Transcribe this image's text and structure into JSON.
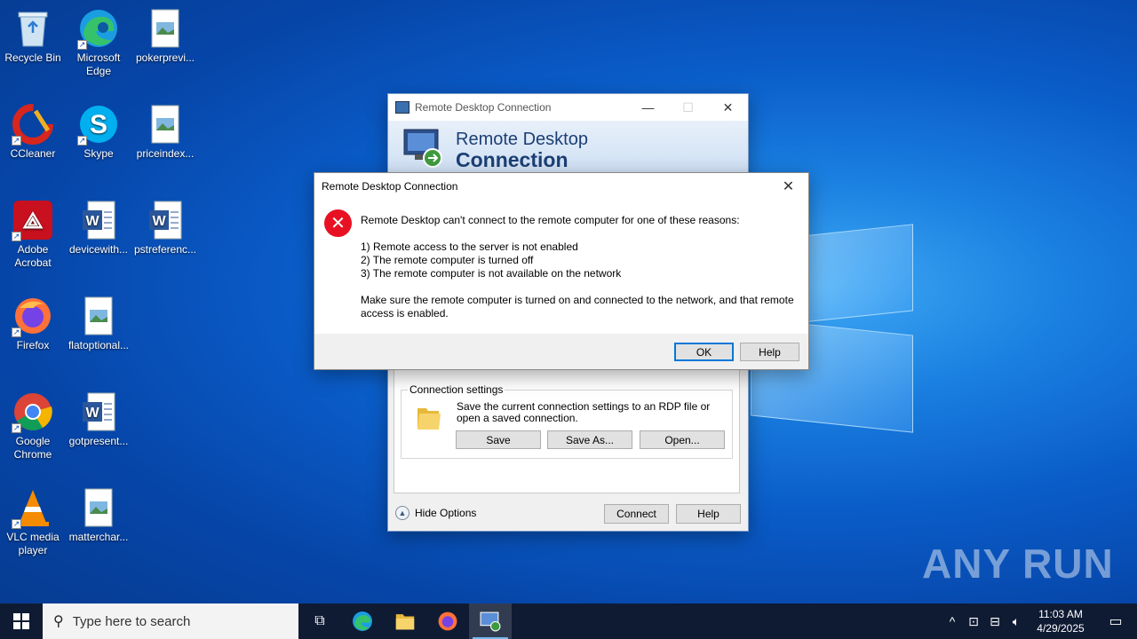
{
  "desktop": {
    "icons": [
      {
        "label": "Recycle Bin",
        "icon": "recycle-bin-icon"
      },
      {
        "label": "Microsoft Edge",
        "icon": "edge-icon"
      },
      {
        "label": "pokerprevi...",
        "icon": "image-file-icon"
      },
      {
        "label": "CCleaner",
        "icon": "ccleaner-icon"
      },
      {
        "label": "Skype",
        "icon": "skype-icon"
      },
      {
        "label": "priceindex...",
        "icon": "image-file-icon"
      },
      {
        "label": "Adobe Acrobat",
        "icon": "acrobat-icon"
      },
      {
        "label": "devicewith...",
        "icon": "word-doc-icon"
      },
      {
        "label": "pstreferenc...",
        "icon": "word-doc-icon"
      },
      {
        "label": "Firefox",
        "icon": "firefox-icon"
      },
      {
        "label": "flatoptional...",
        "icon": "image-file-icon"
      },
      {
        "label": "Google Chrome",
        "icon": "chrome-icon"
      },
      {
        "label": "gotpresent...",
        "icon": "word-doc-icon"
      },
      {
        "label": "VLC media player",
        "icon": "vlc-icon"
      },
      {
        "label": "matterchar...",
        "icon": "image-file-icon"
      }
    ]
  },
  "rdc_window": {
    "title": "Remote Desktop Connection",
    "banner_line1": "Remote Desktop",
    "banner_line2": "Connection",
    "connection_settings": {
      "group_label": "Connection settings",
      "description": "Save the current connection settings to an RDP file or open a saved connection.",
      "save_label": "Save",
      "save_as_label": "Save As...",
      "open_label": "Open..."
    },
    "hide_options_label": "Hide Options",
    "connect_label": "Connect",
    "help_label": "Help"
  },
  "error_dialog": {
    "title": "Remote Desktop Connection",
    "message": "Remote Desktop can't connect to the remote computer for one of these reasons:",
    "reasons": [
      "1) Remote access to the server is not enabled",
      "2) The remote computer is turned off",
      "3) The remote computer is not available on the network"
    ],
    "advice": "Make sure the remote computer is turned on and connected to the network, and that remote access is enabled.",
    "ok_label": "OK",
    "help_label": "Help"
  },
  "taskbar": {
    "search_placeholder": "Type here to search",
    "time": "11:03 AM",
    "date": "4/29/2025"
  },
  "watermark": "ANY RUN"
}
